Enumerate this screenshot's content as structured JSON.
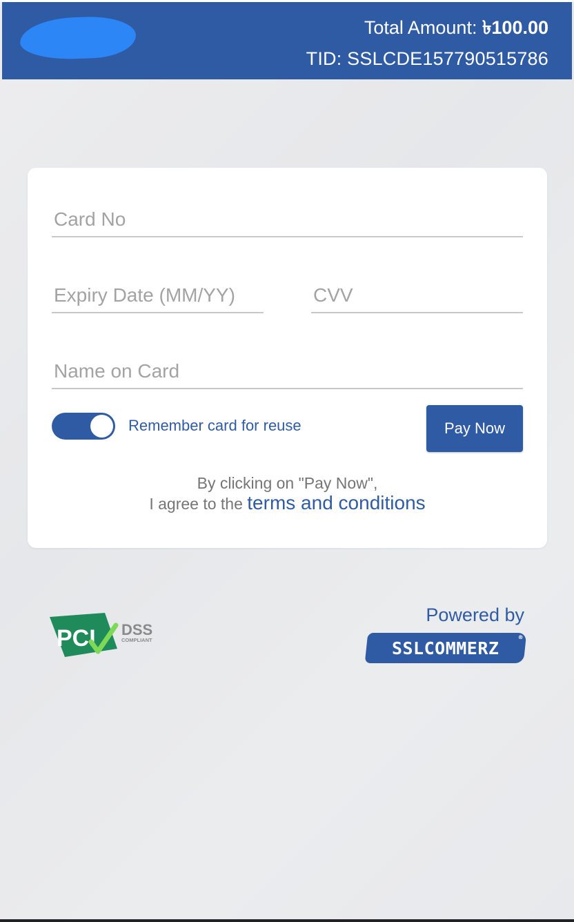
{
  "header": {
    "total_label": "Total Amount: ",
    "total_value": "৳100.00",
    "tid": "TID: SSLCDE157790515786"
  },
  "form": {
    "card_no_placeholder": "Card No",
    "expiry_placeholder": "Expiry Date (MM/YY)",
    "cvv_placeholder": "CVV",
    "name_placeholder": "Name on Card",
    "remember_label": "Remember card for reuse",
    "remember_checked": true,
    "pay_label": "Pay Now",
    "agree_line1": "By clicking on \"Pay Now\",",
    "agree_line2": "I agree to the ",
    "terms_link": "terms and conditions"
  },
  "footer": {
    "pci_text": "PCI",
    "pci_dss": "DSS",
    "pci_compliant": "COMPLIANT",
    "powered_by": "Powered by",
    "brand": "sslcommerz"
  },
  "colors": {
    "primary": "#2f5ba5",
    "redaction": "#2d86f5",
    "pci_green": "#1f8a5a"
  }
}
